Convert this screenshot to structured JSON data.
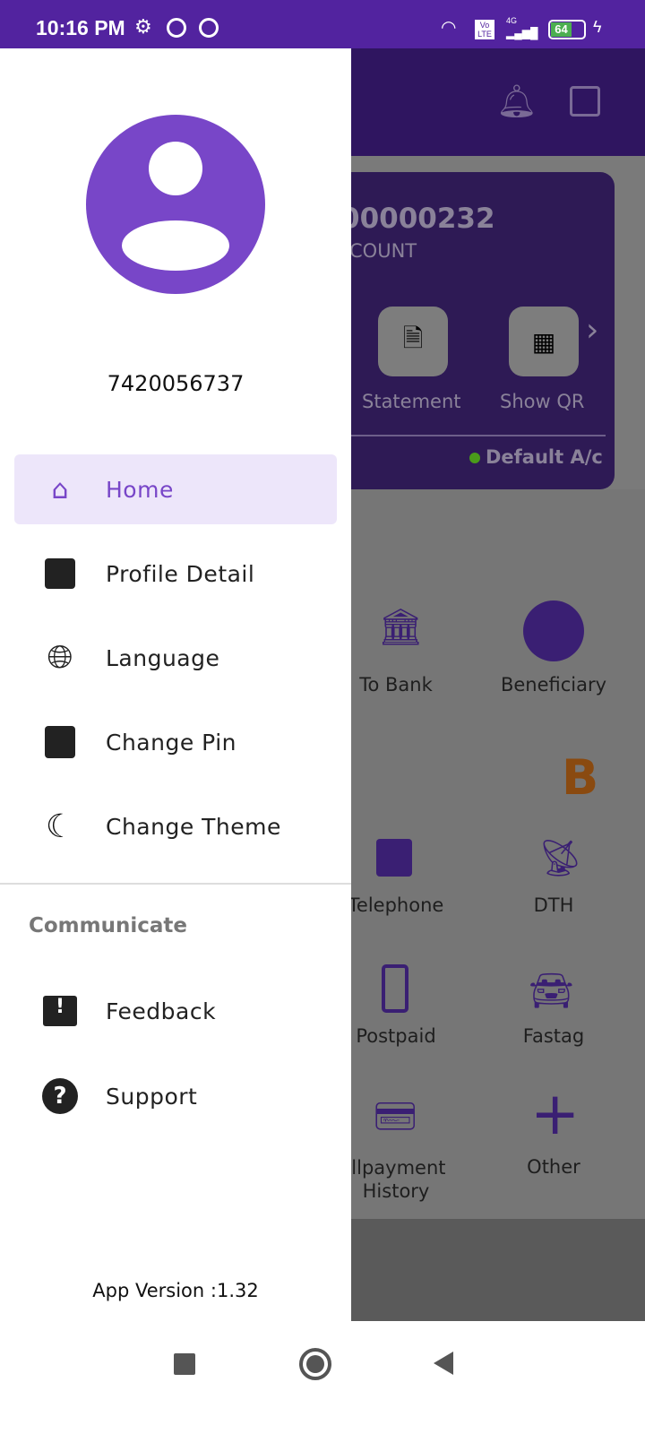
{
  "status_bar": {
    "time": "10:16 PM",
    "battery": "64",
    "network": "4G",
    "volte": "Vo LTE"
  },
  "background": {
    "account_number": "00000232",
    "account_type": "COUNT",
    "actions": [
      {
        "label": "Statement",
        "icon": "statement-icon"
      },
      {
        "label": "Show QR",
        "icon": "qr-icon"
      }
    ],
    "default_label": "Default A/c",
    "services": [
      {
        "label": "To Bank"
      },
      {
        "label": "Beneficiary"
      },
      {
        "label": "Telephone"
      },
      {
        "label": "DTH"
      },
      {
        "label": "Postpaid"
      },
      {
        "label": "Fastag"
      },
      {
        "label": "illpayment History"
      },
      {
        "label": "Other"
      }
    ],
    "brand_letter": "B"
  },
  "drawer": {
    "phone": "7420056737",
    "items": [
      {
        "label": "Home",
        "icon": "home-icon"
      },
      {
        "label": "Profile Detail",
        "icon": "profile-icon"
      },
      {
        "label": "Language",
        "icon": "globe-icon"
      },
      {
        "label": "Change Pin",
        "icon": "pin-icon"
      },
      {
        "label": "Change Theme",
        "icon": "moon-icon"
      }
    ],
    "section": "Communicate",
    "comm_items": [
      {
        "label": "Feedback",
        "icon": "feedback-icon"
      },
      {
        "label": "Support",
        "icon": "help-icon"
      }
    ],
    "version": "App Version :1.32"
  },
  "colors": {
    "primary": "#52239f",
    "accent": "#7846c8",
    "active_bg": "#ede6fa"
  }
}
